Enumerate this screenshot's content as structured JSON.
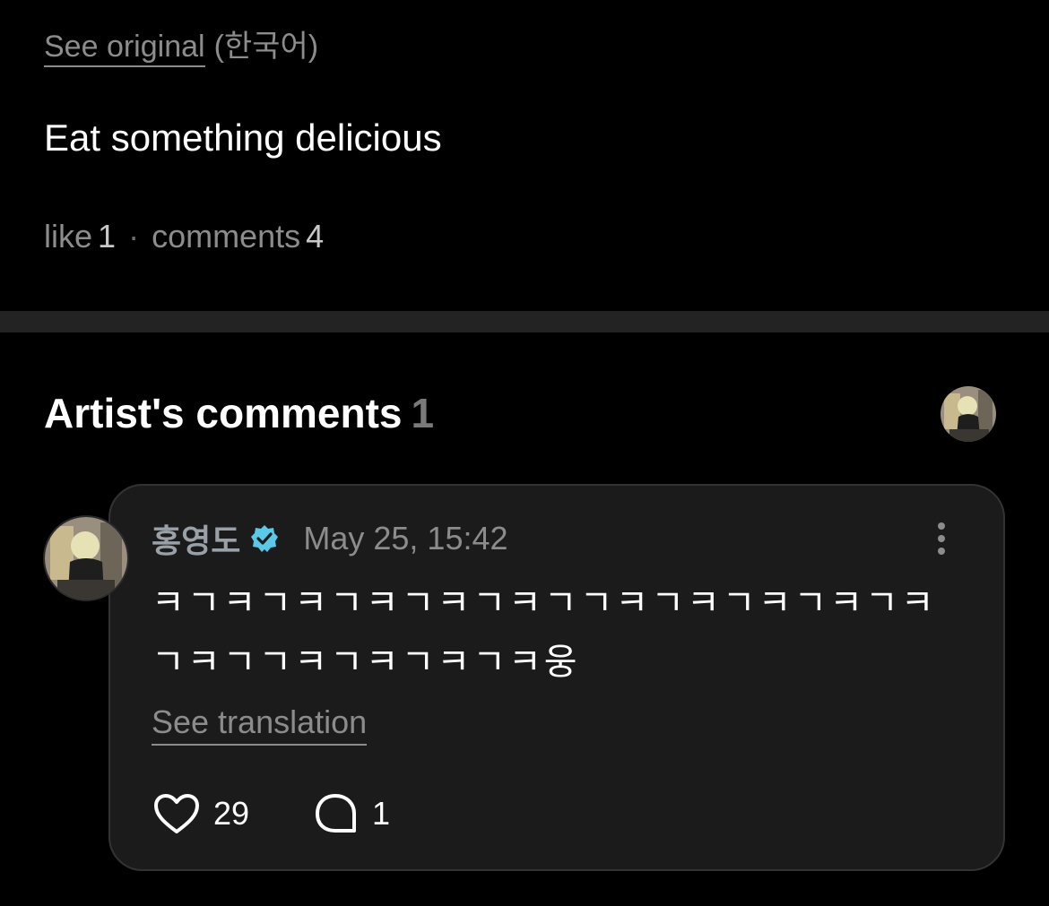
{
  "post": {
    "see_original": "See original",
    "original_language": "(한국어)",
    "body": "Eat something delicious",
    "likes_label": "like",
    "likes_count": "1",
    "separator": "·",
    "comments_label": "comments",
    "comments_count": "4"
  },
  "artist_comments": {
    "title": "Artist's comments",
    "count": "1",
    "comment": {
      "author": "홍영도",
      "timestamp": "May 25, 15:42",
      "text": "ㅋㄱㅋㄱㅋㄱㅋㄱㅋㄱㅋㄱㄱㅋㄱㅋㄱㅋㄱㅋㄱㅋㄱㅋㄱㄱㅋㄱㅋㄱㅋㄱㅋ웅",
      "see_translation": "See translation",
      "like_count": "29",
      "reply_count": "1"
    }
  },
  "colors": {
    "background": "#000000",
    "card": "#1b1b1b",
    "muted_text": "#8c8c8c",
    "verified_badge": "#5cc8e8"
  },
  "icons": {
    "verified": "verified-badge-icon",
    "more": "more-vertical-icon",
    "like": "heart-outline-icon",
    "reply": "comment-bubble-icon"
  }
}
